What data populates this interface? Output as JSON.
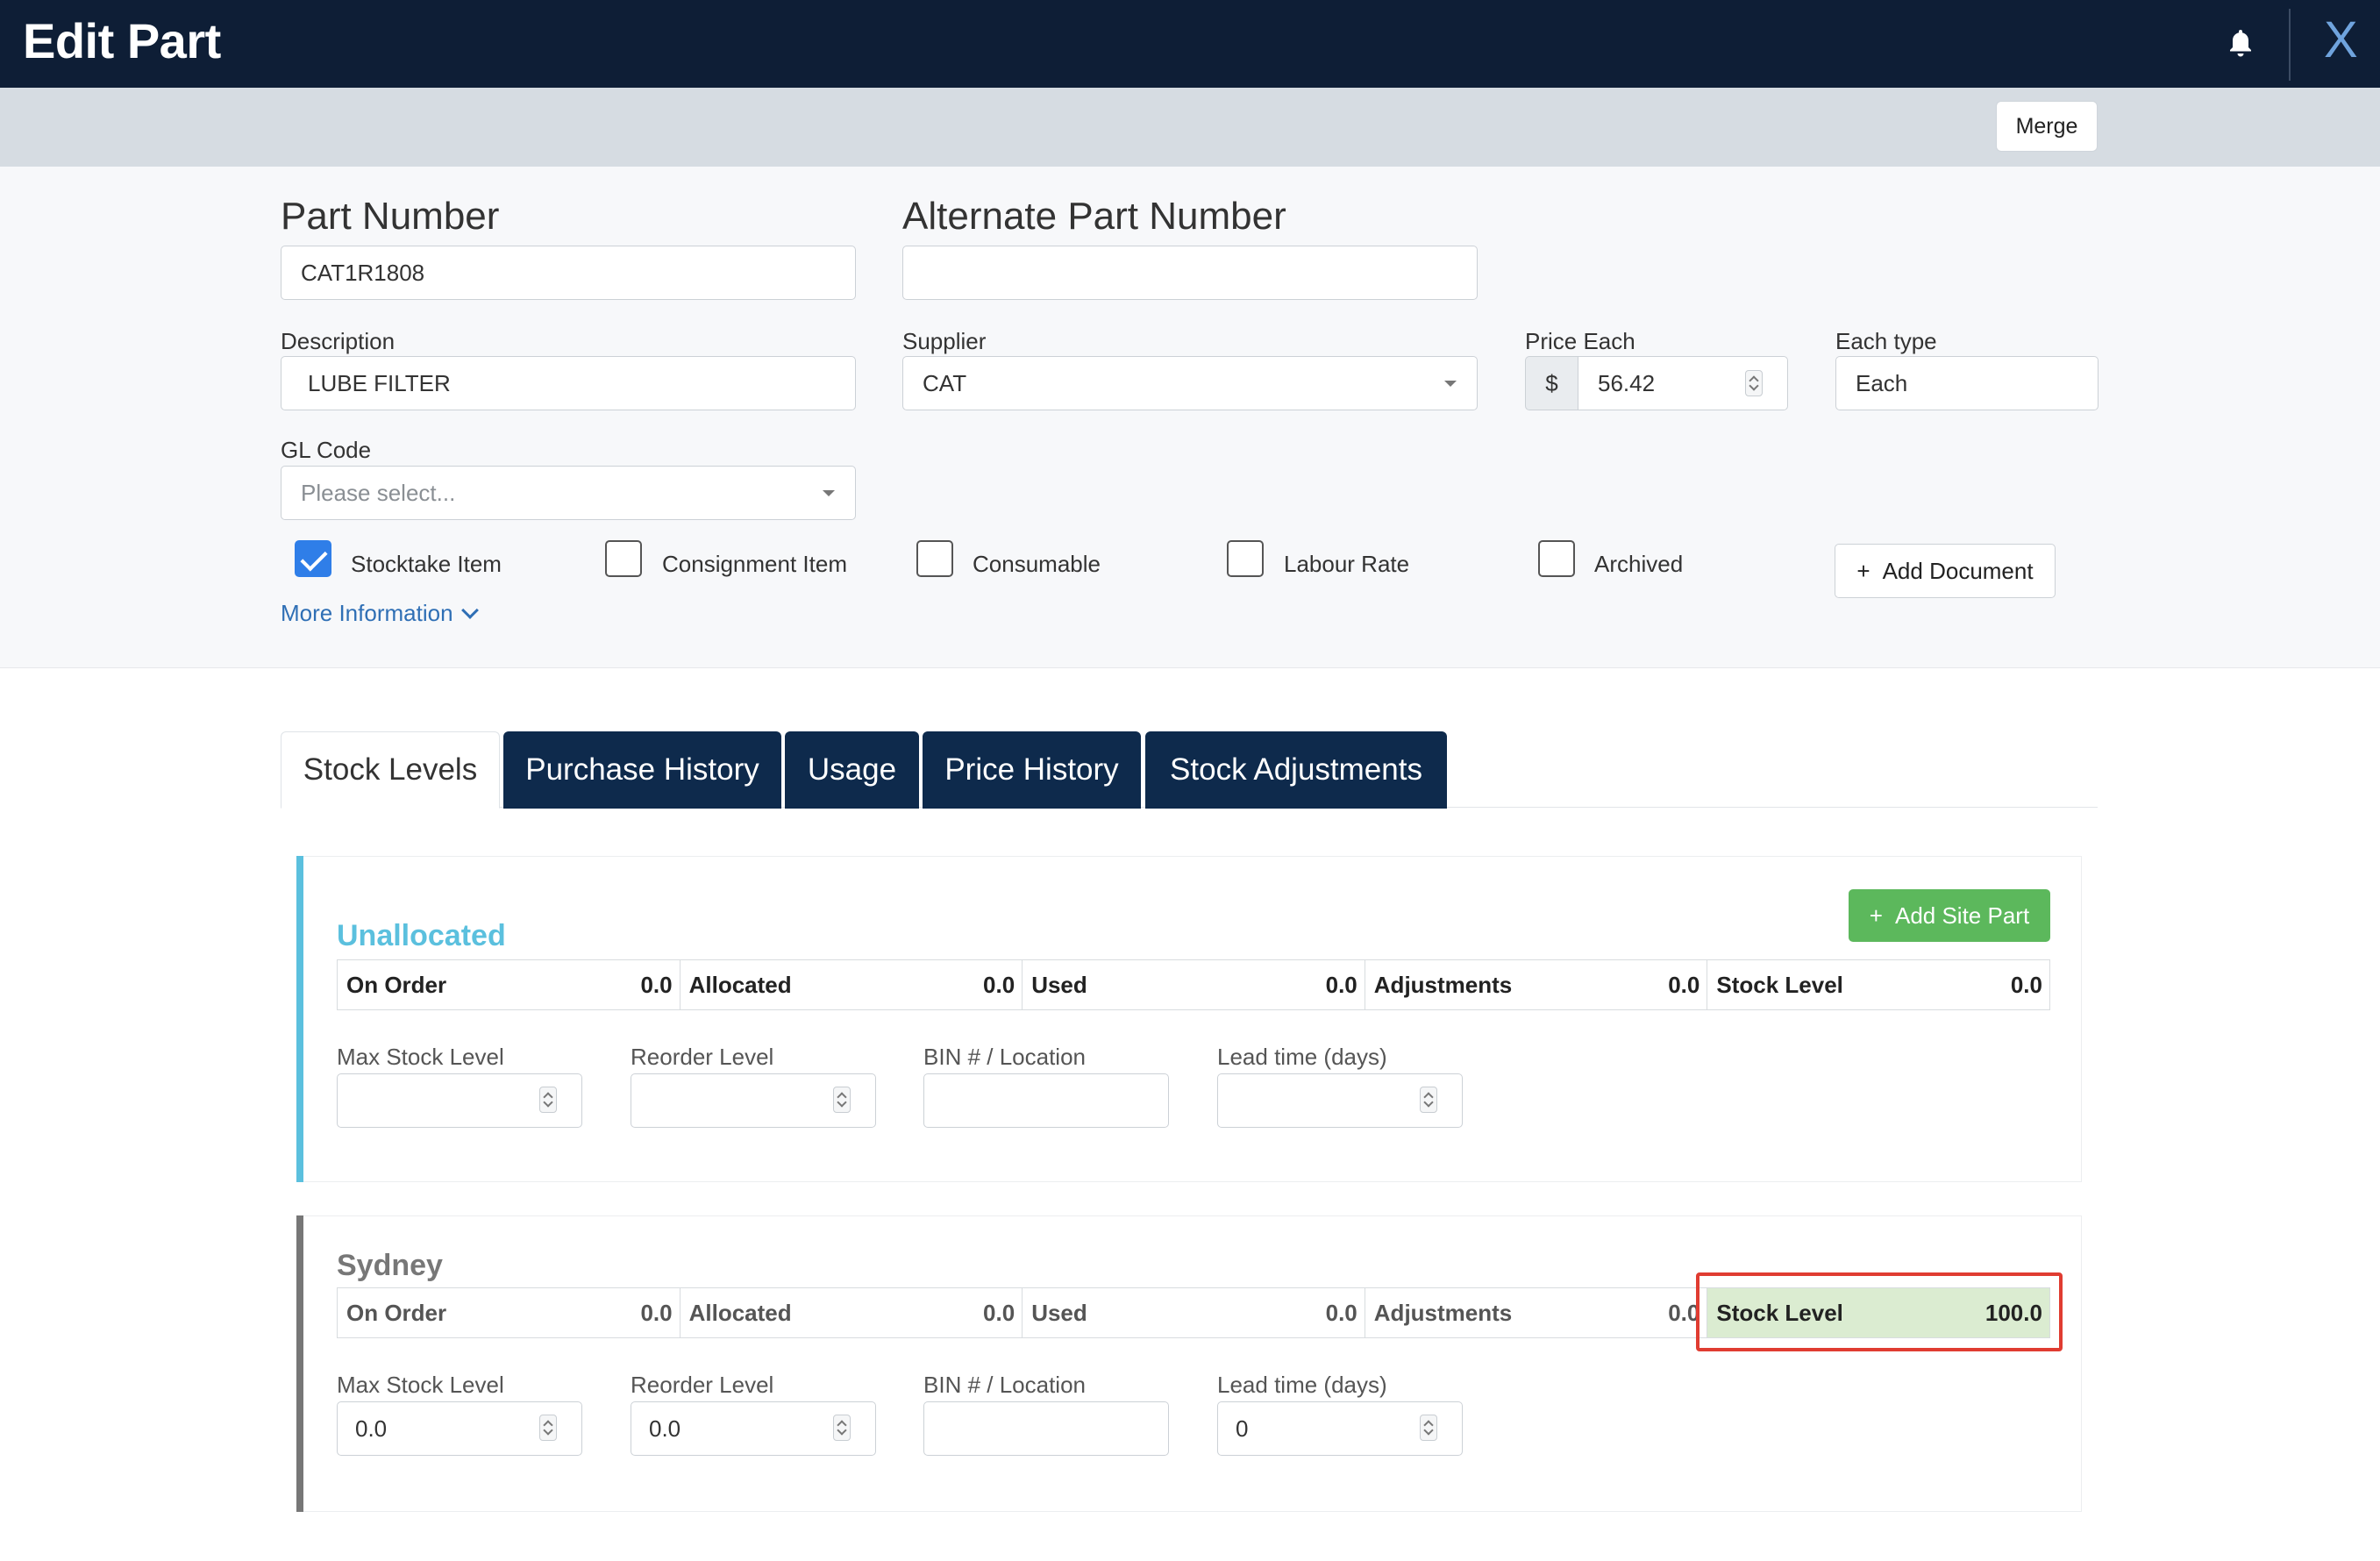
{
  "header": {
    "title": "Edit Part",
    "close_label": "X"
  },
  "toolbar": {
    "merge_label": "Merge"
  },
  "form": {
    "part_number_label": "Part Number",
    "part_number_value": "CAT1R1808",
    "alt_part_number_label": "Alternate Part Number",
    "alt_part_number_value": "",
    "description_label": "Description",
    "description_value": "LUBE FILTER",
    "supplier_label": "Supplier",
    "supplier_value": "CAT",
    "price_label": "Price Each",
    "price_currency": "$",
    "price_value": "56.42",
    "each_type_label": "Each type",
    "each_type_value": "Each",
    "gl_code_label": "GL Code",
    "gl_code_placeholder": "Please select...",
    "checkboxes": [
      {
        "label": "Stocktake Item",
        "checked": true
      },
      {
        "label": "Consignment Item",
        "checked": false
      },
      {
        "label": "Consumable",
        "checked": false
      },
      {
        "label": "Labour Rate",
        "checked": false
      },
      {
        "label": "Archived",
        "checked": false
      }
    ],
    "add_document_label": "Add Document",
    "more_info_label": "More Information"
  },
  "tabs": [
    {
      "label": "Stock Levels",
      "active": true
    },
    {
      "label": "Purchase History",
      "active": false
    },
    {
      "label": "Usage",
      "active": false
    },
    {
      "label": "Price History",
      "active": false
    },
    {
      "label": "Stock Adjustments",
      "active": false
    }
  ],
  "sites": [
    {
      "name": "Unallocated",
      "accent": "#5bc0de",
      "add_site_part_label": "Add Site Part",
      "stats": [
        {
          "label": "On Order",
          "value": "0.0"
        },
        {
          "label": "Allocated",
          "value": "0.0"
        },
        {
          "label": "Used",
          "value": "0.0"
        },
        {
          "label": "Adjustments",
          "value": "0.0"
        },
        {
          "label": "Stock Level",
          "value": "0.0"
        }
      ],
      "fields": [
        {
          "label": "Max Stock Level",
          "value": ""
        },
        {
          "label": "Reorder Level",
          "value": ""
        },
        {
          "label": "BIN # / Location",
          "value": ""
        },
        {
          "label": "Lead time (days)",
          "value": ""
        }
      ]
    },
    {
      "name": "Sydney",
      "accent": "#777777",
      "stats": [
        {
          "label": "On Order",
          "value": "0.0"
        },
        {
          "label": "Allocated",
          "value": "0.0"
        },
        {
          "label": "Used",
          "value": "0.0"
        },
        {
          "label": "Adjustments",
          "value": "0.0"
        },
        {
          "label": "Stock Level",
          "value": "100.0"
        }
      ],
      "fields": [
        {
          "label": "Max Stock Level",
          "value": "0.0"
        },
        {
          "label": "Reorder Level",
          "value": "0.0"
        },
        {
          "label": "BIN # / Location",
          "value": ""
        },
        {
          "label": "Lead time (days)",
          "value": "0"
        }
      ]
    }
  ],
  "colors": {
    "header_bg": "#0e1e36",
    "tab_dark": "#0e2a4c",
    "success": "#5cb85c",
    "highlight": "#e03c31"
  }
}
